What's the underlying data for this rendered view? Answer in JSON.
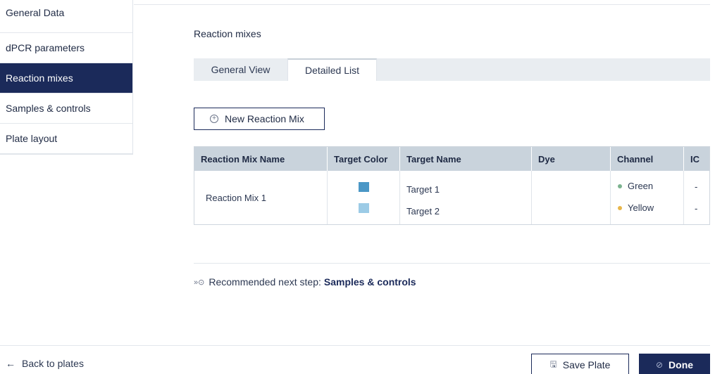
{
  "sidebar": {
    "items": [
      {
        "label": "General Data"
      },
      {
        "label": "dPCR parameters"
      },
      {
        "label": "Reaction mixes"
      },
      {
        "label": "Samples & controls"
      },
      {
        "label": "Plate layout"
      }
    ],
    "active_index": 2
  },
  "main": {
    "section_title": "Reaction mixes",
    "tabs": [
      {
        "label": "General View"
      },
      {
        "label": "Detailed List"
      }
    ],
    "active_tab": 1,
    "new_button_label": "New Reaction Mix",
    "table": {
      "headers": [
        "Reaction Mix Name",
        "Target Color",
        "Target Name",
        "Dye",
        "Channel",
        "IC"
      ],
      "rows": [
        {
          "name": "Reaction Mix 1",
          "targets": [
            {
              "color": "#4b97c6",
              "name": "Target 1",
              "dye": "",
              "channel": "Green",
              "channel_color": "#7cb38f",
              "ic": "-"
            },
            {
              "color": "#9ccbe6",
              "name": "Target 2",
              "dye": "",
              "channel": "Yellow",
              "channel_color": "#e8b64a",
              "ic": "-"
            }
          ]
        }
      ]
    },
    "recommend": {
      "prefix": "Recommended next step:",
      "link": "Samples & controls"
    }
  },
  "footer": {
    "back_label": "Back to plates",
    "save_label": "Save Plate",
    "done_label": "Done"
  },
  "icons": {
    "back": "arrow-left-icon",
    "save": "save-icon",
    "done": "check-circle-icon",
    "add": "plus-circle-icon",
    "recommend": "next-step-icon"
  },
  "colors": {
    "brand_navy": "#1b2a5a",
    "table_header": "#c9d3dc"
  }
}
